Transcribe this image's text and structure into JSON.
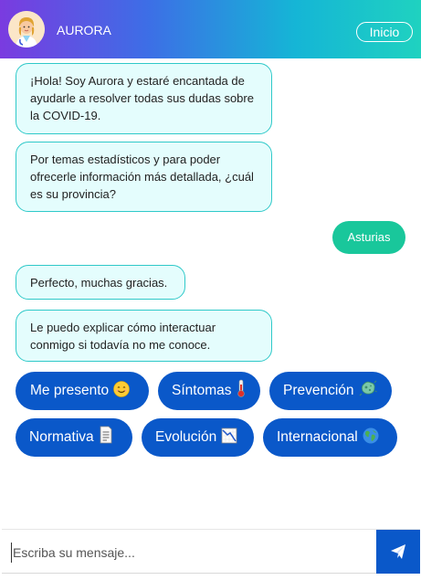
{
  "header": {
    "title": "AURORA",
    "home_label": "Inicio",
    "avatar_icon": "doctor-avatar-icon",
    "gradient_colors": [
      "#7a3be0",
      "#3d6ee6",
      "#15b5d6",
      "#1fd2c0"
    ]
  },
  "messages": [
    {
      "from": "bot",
      "text": "¡Hola! Soy Aurora y estaré encantada de ayudarle a resolver todas sus dudas sobre la COVID-19."
    },
    {
      "from": "bot",
      "text": "Por temas estadísticos y para poder ofrecerle información más detallada, ¿cuál es su provincia?"
    },
    {
      "from": "user",
      "text": "Asturias"
    },
    {
      "from": "bot",
      "text": "Perfecto, muchas gracias."
    },
    {
      "from": "bot",
      "text": "Le puedo explicar cómo interactuar conmigo si todavía no me conoce."
    }
  ],
  "options": [
    {
      "label": "Me presento",
      "icon": "smiling-face-icon"
    },
    {
      "label": "Síntomas",
      "icon": "thermometer-icon"
    },
    {
      "label": "Prevención",
      "icon": "microbe-icon"
    },
    {
      "label": "Normativa",
      "icon": "document-icon"
    },
    {
      "label": "Evolución",
      "icon": "chart-decreasing-icon"
    },
    {
      "label": "Internacional",
      "icon": "globe-icon"
    }
  ],
  "composer": {
    "placeholder": "Escriba su mensaje...",
    "value": "",
    "send_icon": "paper-plane-icon"
  },
  "colors": {
    "bot_bubble_bg": "#e4fdfd",
    "bot_bubble_border": "#2fc9c9",
    "user_bubble_bg": "#19c79b",
    "option_bg": "#0a58c9"
  }
}
